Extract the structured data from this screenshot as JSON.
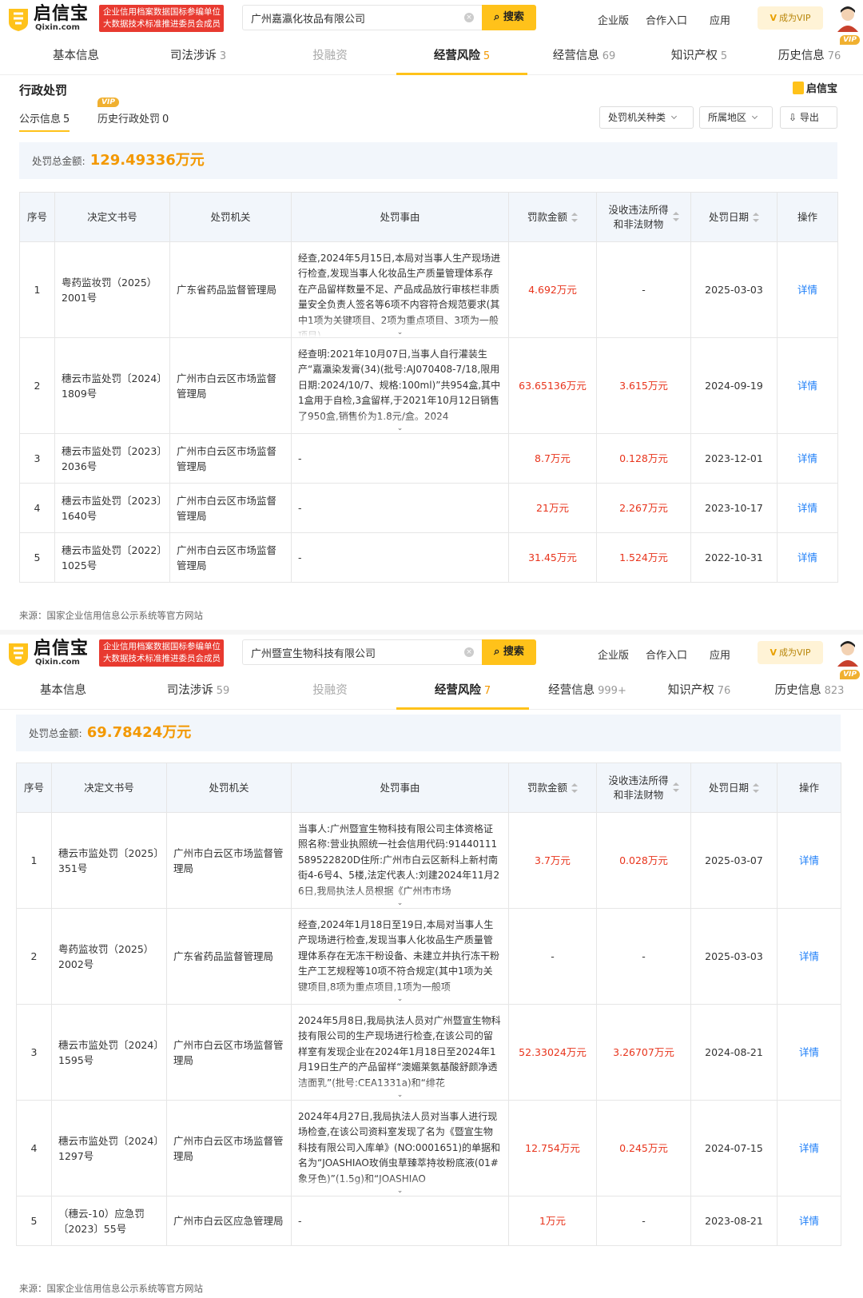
{
  "panels": [
    {
      "search_value": "广州嘉瀛化妆品有限公司",
      "tabs": [
        {
          "label": "基本信息",
          "count": ""
        },
        {
          "label": "司法涉诉",
          "count": "3"
        },
        {
          "label": "投融资",
          "count": ""
        },
        {
          "label": "经营风险",
          "count": "5"
        },
        {
          "label": "经营信息",
          "count": "69"
        },
        {
          "label": "知识产权",
          "count": "5"
        },
        {
          "label": "历史信息",
          "count": "76"
        }
      ],
      "section_title": "行政处罚",
      "subtabs": {
        "public_label": "公示信息",
        "public_count": "5",
        "history_label": "历史行政处罚",
        "history_count": "0"
      },
      "filters": {
        "org_type": "处罚机关种类",
        "region": "所属地区",
        "export": "导出"
      },
      "total_label": "处罚总金额:",
      "total_amount": "129.49336万元",
      "rows": [
        {
          "no": "1",
          "doc": "粤药监妆罚（2025）2001号",
          "org": "广东省药品监督管理局",
          "reason": "经查,2024年5月15日,本局对当事人生产现场进行检查,发现当事人化妆品生产质量管理体系存在产品留样数量不足、产品成品放行审核栏非质量安全负责人签名等6项不内容符合规范要求(其中1项为关键项目、2项为重点项目、3项为一般项目)",
          "fine": "4.692万元",
          "confiscate": "-",
          "date": "2025-03-03"
        },
        {
          "no": "2",
          "doc": "穗云市监处罚〔2024〕1809号",
          "org": "广州市白云区市场监督管理局",
          "reason": "经查明:2021年10月07日,当事人自行灌装生产“嘉瀛染发膏(34)(批号:AJ070408-7/18,限用日期:2024/10/7、规格:100ml)”共954盒,其中1盒用于自检,3盒留样,于2021年10月12日销售了950盒,销售价为1.8元/盒。2024",
          "fine": "63.65136万元",
          "confiscate": "3.615万元",
          "date": "2024-09-19"
        },
        {
          "no": "3",
          "doc": "穗云市监处罚〔2023〕2036号",
          "org": "广州市白云区市场监督管理局",
          "reason": "-",
          "fine": "8.7万元",
          "confiscate": "0.128万元",
          "date": "2023-12-01"
        },
        {
          "no": "4",
          "doc": "穗云市监处罚〔2023〕1640号",
          "org": "广州市白云区市场监督管理局",
          "reason": "-",
          "fine": "21万元",
          "confiscate": "2.267万元",
          "date": "2023-10-17"
        },
        {
          "no": "5",
          "doc": "穗云市监处罚〔2022〕1025号",
          "org": "广州市白云区市场监督管理局",
          "reason": "-",
          "fine": "31.45万元",
          "confiscate": "1.524万元",
          "date": "2022-10-31"
        }
      ],
      "source": "来源：国家企业信用信息公示系统等官方网站"
    },
    {
      "search_value": "广州暨宣生物科技有限公司",
      "tabs": [
        {
          "label": "基本信息",
          "count": ""
        },
        {
          "label": "司法涉诉",
          "count": "59"
        },
        {
          "label": "投融资",
          "count": ""
        },
        {
          "label": "经营风险",
          "count": "7"
        },
        {
          "label": "经营信息",
          "count": "999+"
        },
        {
          "label": "知识产权",
          "count": "76"
        },
        {
          "label": "历史信息",
          "count": "823"
        }
      ],
      "total_label": "处罚总金额:",
      "total_amount": "69.78424万元",
      "rows": [
        {
          "no": "1",
          "doc": "穗云市监处罚〔2025〕351号",
          "org": "广州市白云区市场监督管理局",
          "reason": "当事人:广州暨宣生物科技有限公司主体资格证照名称:营业执照统一社会信用代码:91440111589522820D住所:广州市白云区新科上新村南街4-6号4、5楼,法定代表人:刘建2024年11月26日,我局执法人员根据《广州市市场",
          "fine": "3.7万元",
          "confiscate": "0.028万元",
          "date": "2025-03-07"
        },
        {
          "no": "2",
          "doc": "粤药监妆罚（2025）2002号",
          "org": "广东省药品监督管理局",
          "reason": "经查,2024年1月18日至19日,本局对当事人生产现场进行检查,发现当事人化妆品生产质量管理体系存在无冻干粉设备、未建立并执行冻干粉生产工艺规程等10项不符合规定(其中1项为关键项目,8项为重点项目,1项为一般项",
          "fine": "-",
          "confiscate": "-",
          "date": "2025-03-03"
        },
        {
          "no": "3",
          "doc": "穗云市监处罚〔2024〕1595号",
          "org": "广州市白云区市场监督管理局",
          "reason": "2024年5月8日,我局执法人员对广州暨宣生物科技有限公司的生产现场进行检查,在该公司的留样室有发现企业在2024年1月18日至2024年1月19日生产的产品留样“澳媚莱氨基酸舒颜净透洁面乳”(批号:CEA1331a)和“绯花",
          "fine": "52.33024万元",
          "confiscate": "3.26707万元",
          "date": "2024-08-21"
        },
        {
          "no": "4",
          "doc": "穗云市监处罚〔2024〕1297号",
          "org": "广州市白云区市场监督管理局",
          "reason": "2024年4月27日,我局执法人员对当事人进行现场检查,在该公司资料室发现了名为《暨宣生物科技有限公司入库单》(NO:0001651)的单据和名为“JOASHIAO玫俏虫草臻萃持妆粉底液(01#象牙色)”(1.5g)和“JOASHIAO",
          "fine": "12.754万元",
          "confiscate": "0.245万元",
          "date": "2024-07-15"
        },
        {
          "no": "5",
          "doc": "（穗云-10）应急罚〔2023〕55号",
          "org": "广州市白云区应急管理局",
          "reason": "-",
          "fine": "1万元",
          "confiscate": "-",
          "date": "2023-08-21"
        }
      ],
      "source": "来源：国家企业信用信息公示系统等官方网站"
    }
  ],
  "header": {
    "logo_text": "启信宝",
    "logo_sub": "Qixin.com",
    "badge_line1": "企业信用档案数据国标参编单位",
    "badge_line2": "大数据技术标准推进委员会成员",
    "search_button": "搜索",
    "nav": [
      "企业版",
      "合作入口",
      "应用"
    ],
    "vip_button": "成为VIP",
    "vip_tag": "VIP"
  },
  "columns": {
    "no": "序号",
    "doc": "决定文书号",
    "org": "处罚机关",
    "reason": "处罚事由",
    "fine": "罚款金额",
    "confiscate_line1": "没收违法所得",
    "confiscate_line2": "和非法财物",
    "date": "处罚日期",
    "action": "操作"
  },
  "action_label": "详情",
  "colors": {
    "accent": "#ffc21a",
    "amount": "#f39800",
    "red": "#e8341c",
    "link": "#1c7ef8",
    "header_bg": "#f2f6fb"
  }
}
